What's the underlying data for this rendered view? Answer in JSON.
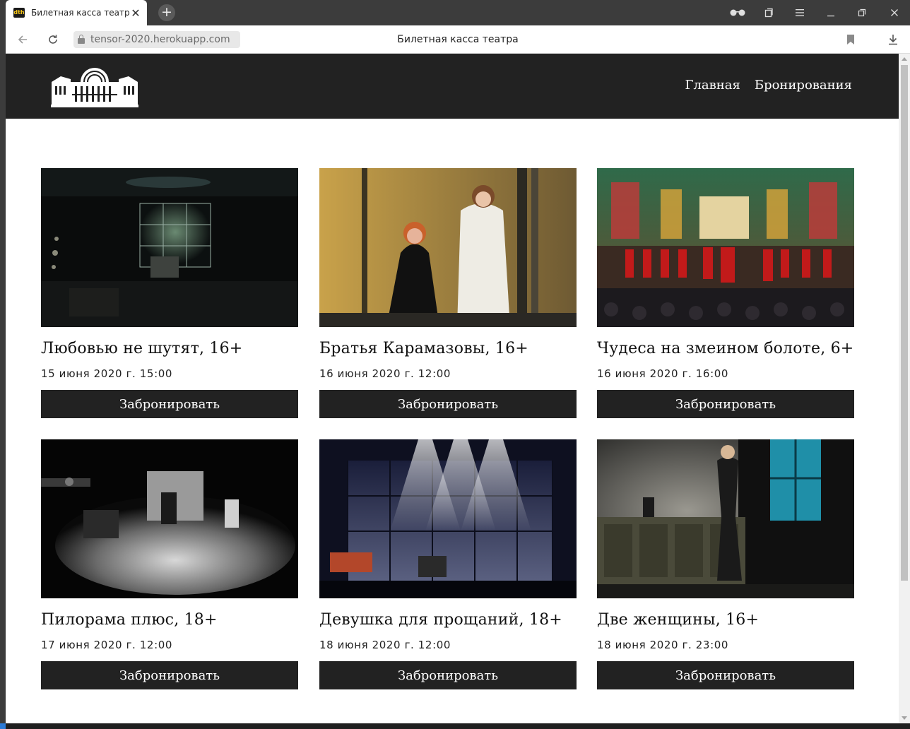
{
  "browser": {
    "tab_title": "Билетная касса театра",
    "favicon_text": "dth",
    "url": "tensor-2020.herokuapp.com",
    "page_title": "Билетная касса театра"
  },
  "site": {
    "nav": [
      "Главная",
      "Бронирования"
    ]
  },
  "shows": [
    {
      "title": "Любовью не шутят, 16+",
      "date": "15 июня 2020 г. 15:00",
      "button": "Забронировать"
    },
    {
      "title": "Братья Карамазовы, 16+",
      "date": "16 июня 2020 г. 12:00",
      "button": "Забронировать"
    },
    {
      "title": "Чудеса на змеином болоте, 6+",
      "date": "16 июня 2020 г. 16:00",
      "button": "Забронировать"
    },
    {
      "title": "Пилорама плюс, 18+",
      "date": "17 июня 2020 г. 12:00",
      "button": "Забронировать"
    },
    {
      "title": "Девушка для прощаний, 18+",
      "date": "18 июня 2020 г. 12:00",
      "button": "Забронировать"
    },
    {
      "title": "Две женщины, 16+",
      "date": "18 июня 2020 г. 23:00",
      "button": "Забронировать"
    }
  ],
  "colors": {
    "header_bg": "#222222",
    "button_bg": "#222222",
    "page_bg": "#ffffff"
  }
}
